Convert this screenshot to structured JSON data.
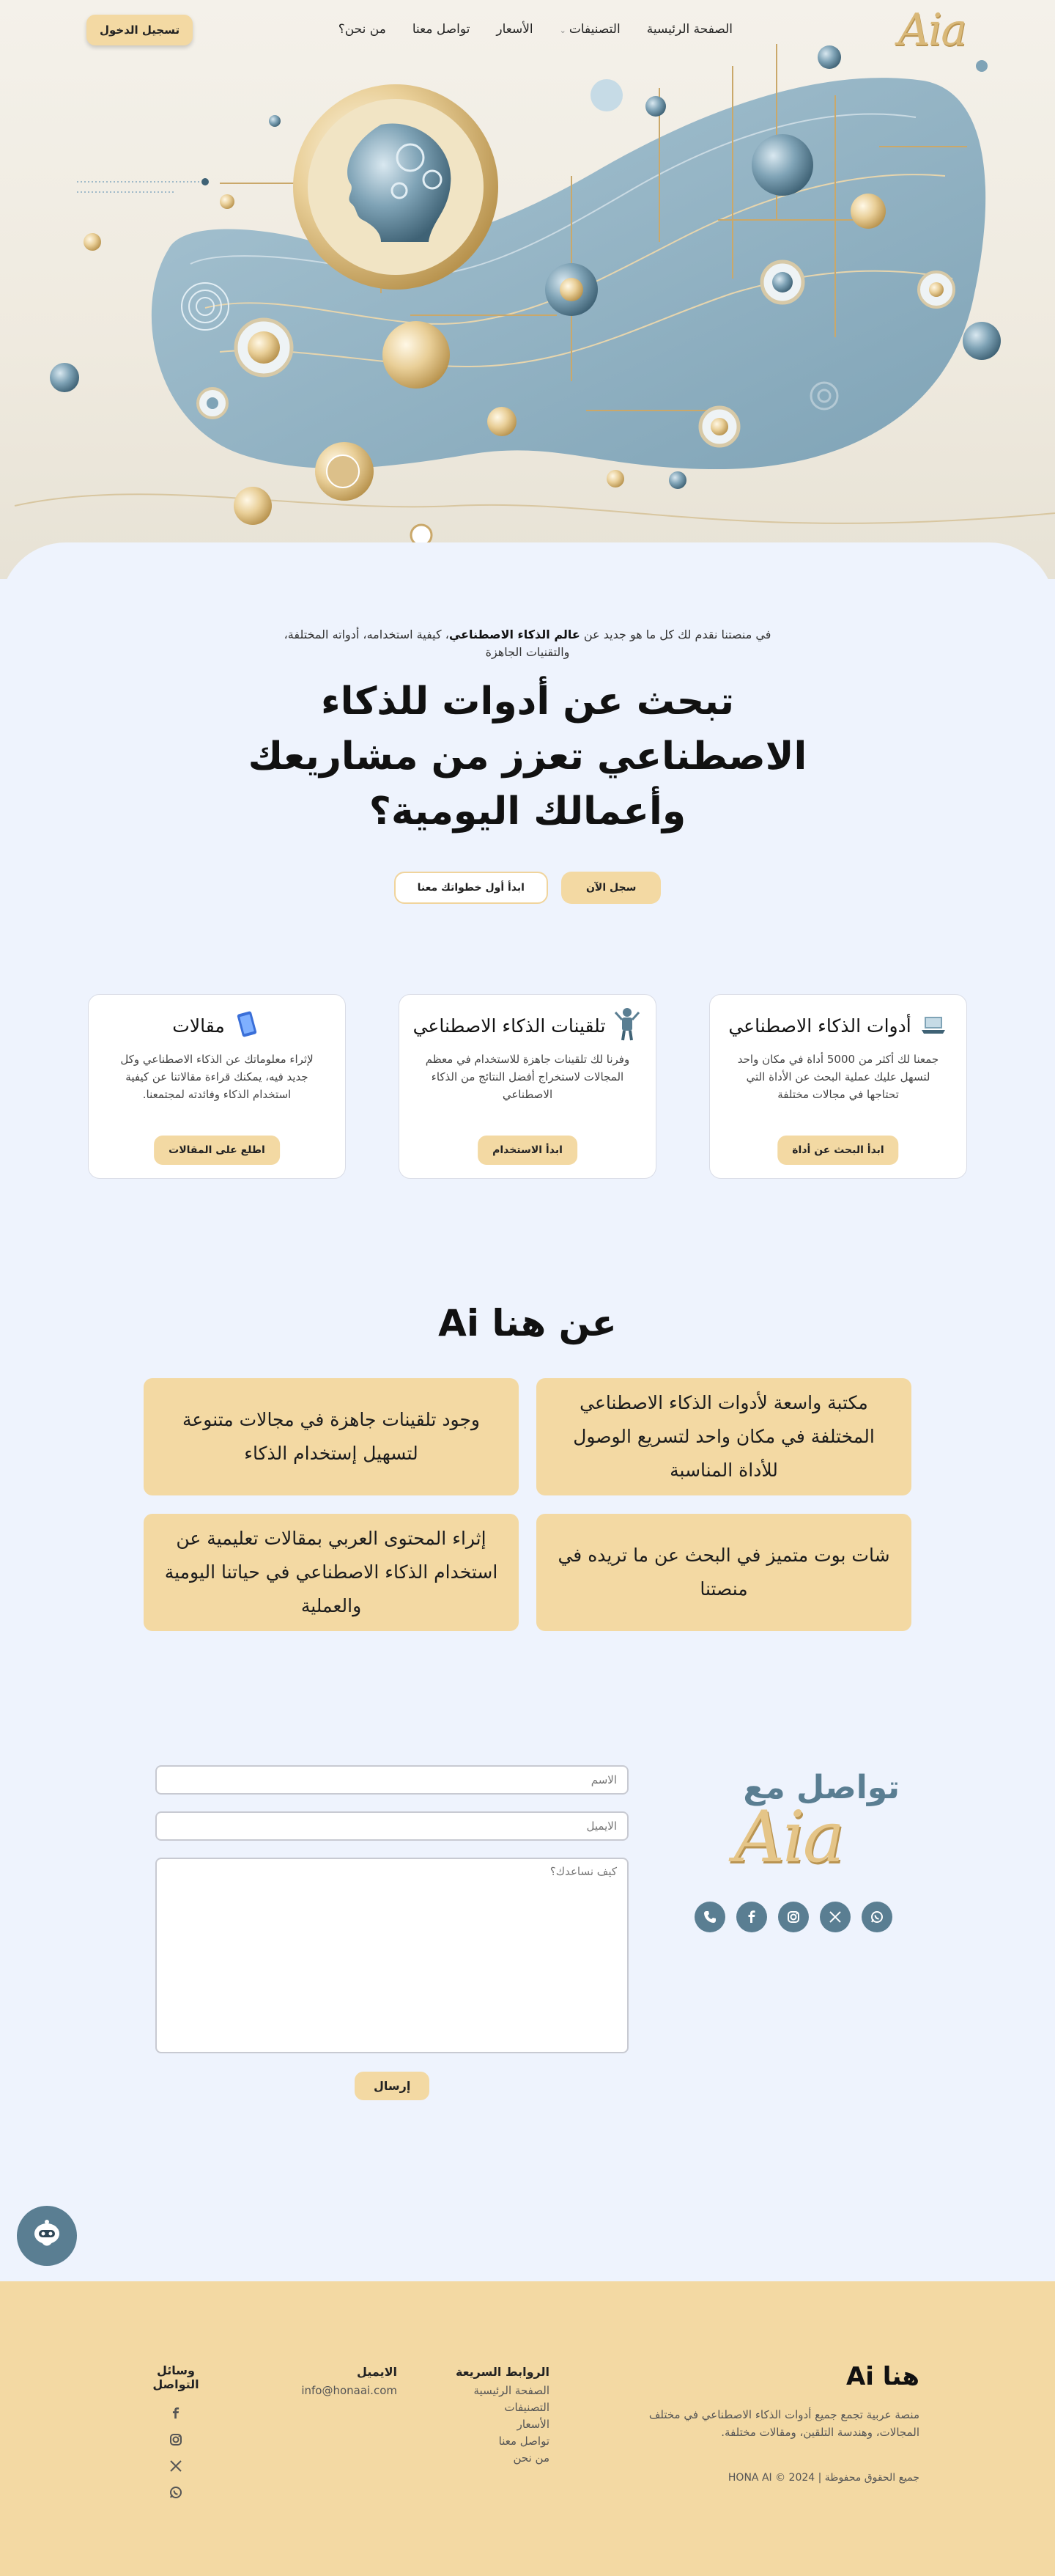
{
  "nav": {
    "logo": "Aia",
    "links": [
      "الصفحة الرئيسية",
      "التصنيفات",
      "الأسعار",
      "تواصل معنا",
      "من نحن؟"
    ],
    "login": "تسجيل الدخول"
  },
  "hero": {
    "intro_pre": "في منصتنا نقدم لك كل ما هو جديد عن ",
    "intro_bold": "عالم الذكاء الاصطناعي",
    "intro_post": "، كيفية استخدامه، أدواته المختلفة، والتقنيات الجاهزة",
    "headline": "تبحث عن أدوات للذكاء الاصطناعي تعزز من مشاريعك وأعمالك اليومية؟",
    "cta_primary": "سجل الآن",
    "cta_secondary": "ابدأ أول خطواتك معنا"
  },
  "cards": [
    {
      "title": "أدوات الذكاء الاصطناعي",
      "desc": "جمعنا لك أكثر من 5000 أداة في مكان واحد لتسهل عليك عملية البحث عن الأداة التي تحتاجها في مجالات مختلفة",
      "button": "ابدأ البحث عن أداة",
      "icon": "laptop-icon"
    },
    {
      "title": "تلقينات الذكاء الاصطناعي",
      "desc": "وفرنا لك تلقينات جاهزة للاستخدام في معظم المجالات لاستخراج أفضل النتائج من الذكاء الاصطناعي",
      "button": "ابدأ الاستخدام",
      "icon": "robot-icon"
    },
    {
      "title": "مقالات",
      "desc": "لإثراء معلوماتك عن الذكاء الاصطناعي وكل جديد فيه، يمكنك قراءة مقالاتنا عن كيفية استخدام الذكاء وفائدته لمجتمعنا.",
      "button": "اطلع على المقالات",
      "icon": "tablet-icon"
    }
  ],
  "about": {
    "title": "عن هنا Ai",
    "items": [
      "مكتبة واسعة لأدوات الذكاء الاصطناعي المختلفة في مكان واحد لتسريع الوصول للأداة المناسبة",
      "وجود تلقينات جاهزة في مجالات متنوعة لتسهيل إستخدام الذكاء",
      "شات بوت متميز في البحث عن ما تريده في منصتنا",
      "إثراء المحتوى العربي بمقالات تعليمية عن استخدام الذكاء الاصطناعي في حياتنا اليومية والعملية"
    ]
  },
  "contact": {
    "title": "تواصل مع",
    "logo": "Aia",
    "name_placeholder": "الاسم",
    "email_placeholder": "الايميل",
    "message_placeholder": "كيف نساعدك؟",
    "send": "إرسال"
  },
  "footer": {
    "brand": "هنا Ai",
    "tagline": "منصة عربية تجمع جميع أدوات الذكاء الاصطناعي في مختلف المجالات، وهندسة التلقين، ومقالات مختلفة.",
    "copyright": "جميع الحقوق محفوظة | HONA AI © 2024",
    "links_title": "الروابط السريعة",
    "links": [
      "الصفحة الرئيسية",
      "التصنيفات",
      "الأسعار",
      "تواصل معنا",
      "من نحن"
    ],
    "email_title": "الايميل",
    "email": "info@honaai.com",
    "social_title": "وسائل التواصل"
  },
  "colors": {
    "gold": "#f3d9a3",
    "slate": "#5a7e92",
    "page_bg": "#eef3fd"
  }
}
